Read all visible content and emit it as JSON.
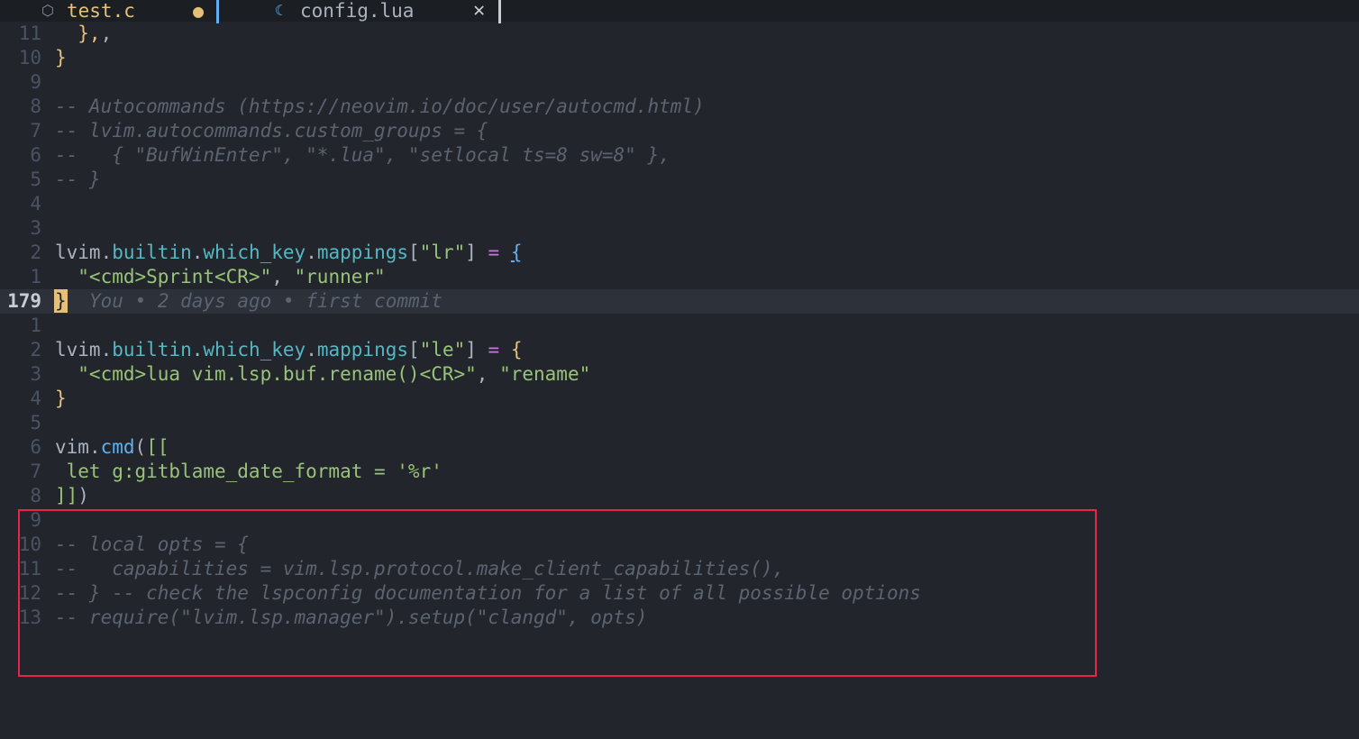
{
  "tabs": [
    {
      "label": "test.c",
      "icon": "c-file-icon",
      "modified_indicator": "●",
      "color": "#e5c07b",
      "separator_color": "#61afef"
    },
    {
      "label": "config.lua",
      "icon": "lua-file-icon",
      "close_label": "✕",
      "color": "#abb2bf",
      "separator_color": "#c8ccd4"
    }
  ],
  "icons": {
    "c": "⬡",
    "lua": "☾"
  },
  "editor": {
    "current_line_number": "179",
    "blame": "You • 2 days ago • first commit",
    "line_numbers": [
      "11",
      "10",
      "9",
      "8",
      "7",
      "6",
      "5",
      "4",
      "3",
      "2",
      "1",
      "179",
      "1",
      "2",
      "3",
      "4",
      "5",
      "6",
      "7",
      "8",
      "9",
      "10",
      "11",
      "12",
      "13"
    ],
    "lines": [
      [
        {
          "t": "  },",
          "c": "t-br"
        },
        {
          "t": ",",
          "c": "t-pl"
        }
      ],
      [
        {
          "t": "}",
          "c": "t-br"
        }
      ],
      [],
      [
        {
          "t": "-- Autocommands (https://neovim.io/doc/user/autocmd.html)",
          "c": "t-com"
        }
      ],
      [
        {
          "t": "-- lvim.autocommands.custom_groups = {",
          "c": "t-com"
        }
      ],
      [
        {
          "t": "--   { \"BufWinEnter\", \"*.lua\", \"setlocal ts=8 sw=8\" },",
          "c": "t-com"
        }
      ],
      [
        {
          "t": "-- }",
          "c": "t-com"
        }
      ],
      [],
      [],
      [
        {
          "t": "lvim",
          "c": "t-pl"
        },
        {
          "t": ".",
          "c": "t-pl"
        },
        {
          "t": "builtin",
          "c": "t-fld"
        },
        {
          "t": ".",
          "c": "t-pl"
        },
        {
          "t": "which_key",
          "c": "t-fld"
        },
        {
          "t": ".",
          "c": "t-pl"
        },
        {
          "t": "mappings",
          "c": "t-fld"
        },
        {
          "t": "[",
          "c": "t-pl"
        },
        {
          "t": "\"lr\"",
          "c": "t-str"
        },
        {
          "t": "] ",
          "c": "t-pl"
        },
        {
          "t": "=",
          "c": "t-op"
        },
        {
          "t": " ",
          "c": "t-pl"
        },
        {
          "t": "{",
          "c": "t-fn t-und"
        }
      ],
      [
        {
          "t": "  \"<cmd>Sprint<CR>\"",
          "c": "t-str"
        },
        {
          "t": ", ",
          "c": "t-pl"
        },
        {
          "t": "\"runner\"",
          "c": "t-str"
        }
      ],
      [
        {
          "t": "}",
          "c": "cursor-block"
        }
      ],
      [],
      [
        {
          "t": "lvim",
          "c": "t-pl"
        },
        {
          "t": ".",
          "c": "t-pl"
        },
        {
          "t": "builtin",
          "c": "t-fld"
        },
        {
          "t": ".",
          "c": "t-pl"
        },
        {
          "t": "which_key",
          "c": "t-fld"
        },
        {
          "t": ".",
          "c": "t-pl"
        },
        {
          "t": "mappings",
          "c": "t-fld"
        },
        {
          "t": "[",
          "c": "t-pl"
        },
        {
          "t": "\"le\"",
          "c": "t-str"
        },
        {
          "t": "] ",
          "c": "t-pl"
        },
        {
          "t": "=",
          "c": "t-op"
        },
        {
          "t": " ",
          "c": "t-pl"
        },
        {
          "t": "{",
          "c": "t-br"
        }
      ],
      [
        {
          "t": "  \"<cmd>lua vim.lsp.buf.rename()<CR>\"",
          "c": "t-str"
        },
        {
          "t": ", ",
          "c": "t-pl"
        },
        {
          "t": "\"rename\"",
          "c": "t-str"
        }
      ],
      [
        {
          "t": "}",
          "c": "t-br"
        }
      ],
      [],
      [
        {
          "t": "vim",
          "c": "t-pl"
        },
        {
          "t": ".",
          "c": "t-pl"
        },
        {
          "t": "cmd",
          "c": "t-fn"
        },
        {
          "t": "(",
          "c": "t-pl"
        },
        {
          "t": "[[",
          "c": "t-str"
        }
      ],
      [
        {
          "t": " let g:gitblame_date_format = '%r'",
          "c": "t-str"
        }
      ],
      [
        {
          "t": "]]",
          "c": "t-str"
        },
        {
          "t": ")",
          "c": "t-pl"
        }
      ],
      [],
      [
        {
          "t": "-- local opts = {",
          "c": "t-com"
        }
      ],
      [
        {
          "t": "--   capabilities = vim.lsp.protocol.make_client_capabilities(),",
          "c": "t-com"
        }
      ],
      [
        {
          "t": "-- } -- check the lspconfig documentation for a list of all possible options",
          "c": "t-com"
        }
      ],
      [
        {
          "t": "-- require(\"lvim.lsp.manager\").setup(\"clangd\", opts)",
          "c": "t-com"
        }
      ]
    ]
  },
  "colors": {
    "background": "#22262c",
    "current_line": "#2c313a",
    "highlight_box": "#e8244a"
  }
}
